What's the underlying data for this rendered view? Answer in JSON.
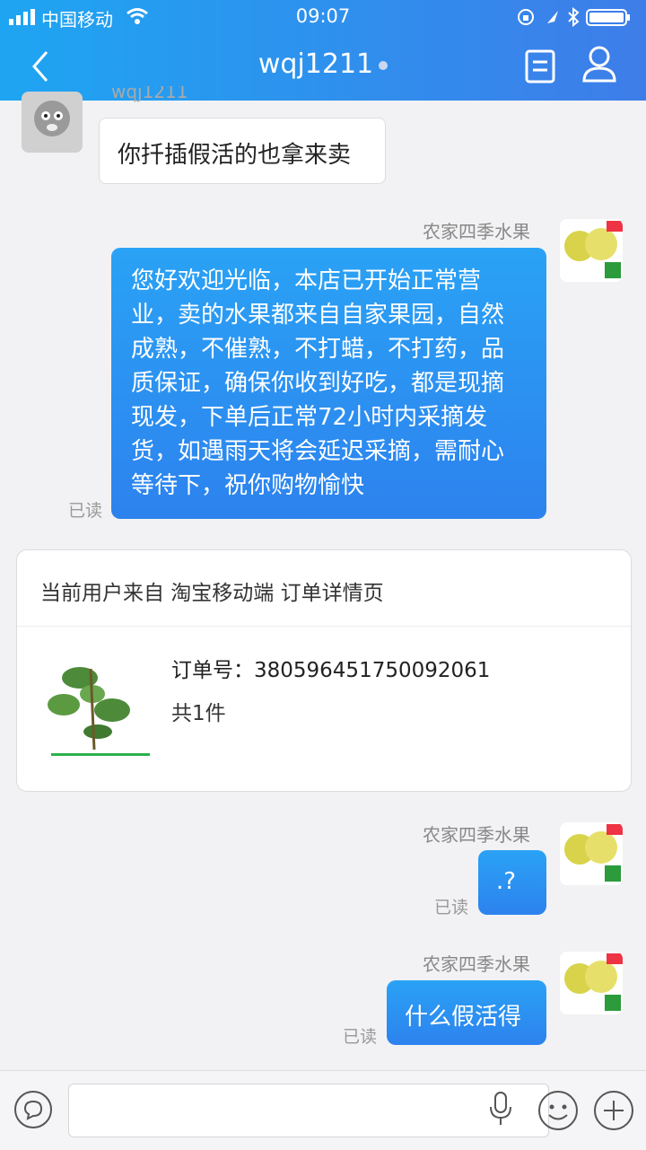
{
  "status": {
    "carrier": "中国移动",
    "time": "09:07"
  },
  "nav": {
    "title": "wqj1211"
  },
  "messages": [
    {
      "sender": "wqj1211",
      "text": "你扦插假活的也拿来卖"
    },
    {
      "sender": "农家四季水果",
      "lines": [
        "您好欢迎光临，本店已开始正常营",
        "业，卖的水果都来自自家果园，自然",
        "成熟，不催熟，不打蜡，不打药，品",
        "质保证，确保你收到好吃，都是现摘",
        "现发，下单后正常72小时内采摘发",
        "货，如遇雨天将会延迟采摘，需耐心",
        "等待下，祝你购物愉快"
      ],
      "status": "已读"
    },
    {
      "sender": "农家四季水果",
      "text": ".?",
      "status": "已读"
    },
    {
      "sender": "农家四季水果",
      "text": "什么假活得",
      "status": "已读"
    }
  ],
  "order_card": {
    "source": "当前用户来自 淘宝移动端 订单详情页",
    "order_no": "订单号：380596451750092061",
    "count": "共1件"
  },
  "colors": {
    "header_start": "#1ea5f2",
    "header_end": "#3e7de9",
    "bubble": "#2a8ff0"
  }
}
